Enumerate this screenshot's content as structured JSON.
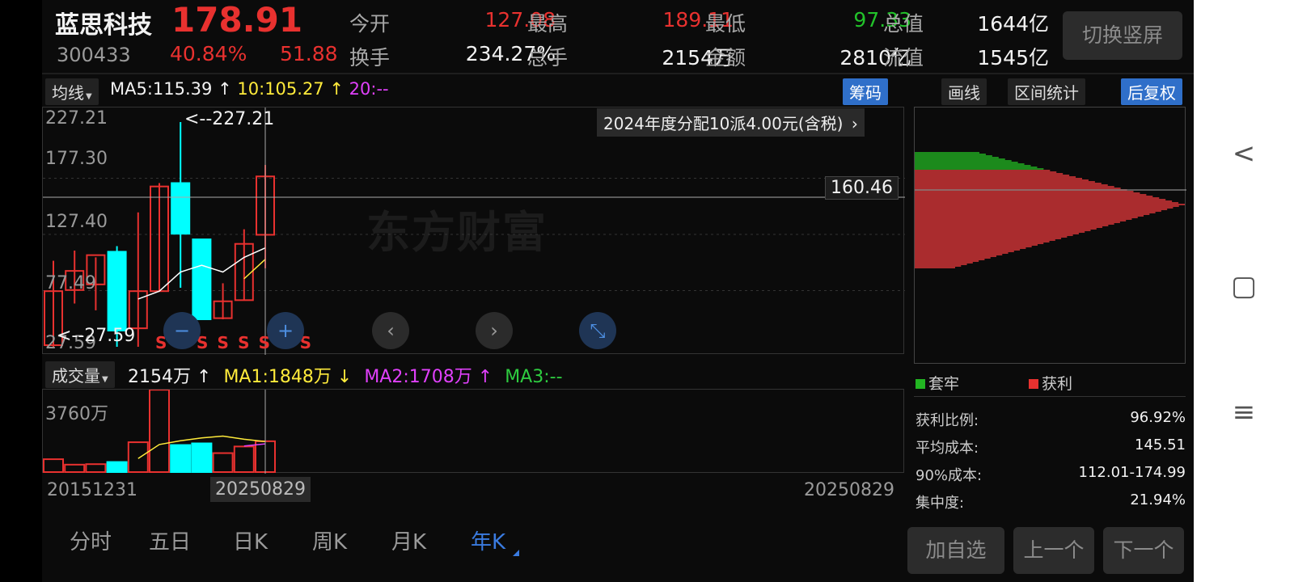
{
  "header": {
    "stock_name": "蓝思科技",
    "price": "178.91",
    "code": "300433",
    "change_pct": "40.84%",
    "change_amt": "51.88",
    "open_label": "今开",
    "open_value": "127.08",
    "high_label": "最高",
    "high_value": "189.11",
    "low_label": "最低",
    "low_value": "97.33",
    "total_value_label": "总值",
    "total_value": "1644亿",
    "turnover_label": "换手",
    "turnover_value": "234.27%",
    "volume_label": "总手",
    "volume_value": "2154万",
    "amount_label": "金额",
    "amount_value": "2810亿",
    "float_value_label": "流值",
    "float_value": "1545亿",
    "toggle_button": "切换竖屏"
  },
  "ma_bar": {
    "selector": "均线",
    "ma5": "MA5:115.39",
    "ma10": "10:105.27",
    "ma20": "20:--",
    "chips_button": "筹码",
    "draw_button": "画线",
    "interval_button": "区间统计",
    "adjust_button": "后复权",
    "up_arrow": "↑",
    "down_arrow": "↓"
  },
  "main_chart": {
    "y_labels": [
      "227.21",
      "177.30",
      "127.40",
      "77.49",
      "27.59"
    ],
    "max_marker": "<--227.21",
    "min_marker": "<--27.59",
    "crosshair_price": "160.46",
    "dividend_banner": "2024年度分配10派4.00元(含税)",
    "dividend_arrow": "›",
    "watermark": "东方财富",
    "s_marker": "S",
    "ctl_minus": "−",
    "ctl_plus": "+",
    "ctl_left": "‹",
    "ctl_right": "›",
    "ctl_compress": "⤡"
  },
  "volume_bar": {
    "selector": "成交量",
    "value": "2154万",
    "ma1": "MA1:1848万",
    "ma2": "MA2:1708万",
    "ma3": "MA3:--",
    "y_label": "3760万",
    "start_date": "20151231",
    "cursor_date": "20250829",
    "end_date": "20250829"
  },
  "chip_panel": {
    "legend_trapped": "套牢",
    "legend_profit": "获利",
    "profit_ratio_label": "获利比例:",
    "profit_ratio": "96.92%",
    "avg_cost_label": "平均成本:",
    "avg_cost": "145.51",
    "cost90_label": "90%成本:",
    "cost90": "112.01-174.99",
    "concentration_label": "集中度:",
    "concentration": "21.94%"
  },
  "tabs": [
    "分时",
    "五日",
    "日K",
    "周K",
    "月K",
    "年K"
  ],
  "bottom_buttons": {
    "add_watch": "加自选",
    "prev": "上一个",
    "next": "下一个"
  },
  "nav": {
    "back": "<",
    "home": "▢",
    "menu": "≡"
  },
  "colors": {
    "up": "#e8312f",
    "down": "#00ffff",
    "ma5": "#ffffff",
    "ma10": "#ffeb3b",
    "ma20": "#e040fb",
    "active_tab": "#3a7be0"
  },
  "chart_data": {
    "type": "candlestick",
    "candles": [
      {
        "o": 29,
        "h": 104,
        "l": 27.59,
        "c": 77
      },
      {
        "o": 78,
        "h": 113,
        "l": 66,
        "c": 95
      },
      {
        "o": 83,
        "h": 107,
        "l": 60,
        "c": 109
      },
      {
        "o": 112,
        "h": 117,
        "l": 27.59,
        "c": 42
      },
      {
        "o": 44,
        "h": 147,
        "l": 27.59,
        "c": 77
      },
      {
        "o": 77,
        "h": 173,
        "l": 77,
        "c": 170
      },
      {
        "o": 173,
        "h": 227.21,
        "l": 80,
        "c": 128
      },
      {
        "o": 123,
        "h": 123,
        "l": 53,
        "c": 52
      },
      {
        "o": 53,
        "h": 84,
        "l": 52,
        "c": 68
      },
      {
        "o": 69,
        "h": 132,
        "l": 69,
        "c": 119
      },
      {
        "o": 127.08,
        "h": 189.11,
        "l": 97.33,
        "c": 178.91
      }
    ],
    "ma5_line": [
      null,
      null,
      null,
      null,
      70,
      77,
      94,
      100,
      94,
      107,
      115.39
    ],
    "ma10_line": [
      null,
      null,
      null,
      null,
      null,
      null,
      null,
      null,
      null,
      88,
      105.27
    ],
    "volume": {
      "unit": "万",
      "values": [
        780,
        450,
        480,
        610,
        1810,
        4990,
        1640,
        1740,
        1150,
        1550,
        1870
      ],
      "down": [
        false,
        false,
        false,
        true,
        false,
        false,
        true,
        true,
        false,
        false,
        false
      ],
      "ma1": [
        null,
        null,
        null,
        null,
        820,
        1670,
        1900,
        2070,
        2180,
        1990,
        1848
      ],
      "ma2": [
        null,
        null,
        null,
        null,
        null,
        null,
        null,
        null,
        null,
        1580,
        1708
      ]
    },
    "y_range": [
      27.59,
      227.21
    ],
    "vol_range": [
      0,
      5000
    ],
    "start_date": "20151231",
    "end_date": "20250829"
  }
}
